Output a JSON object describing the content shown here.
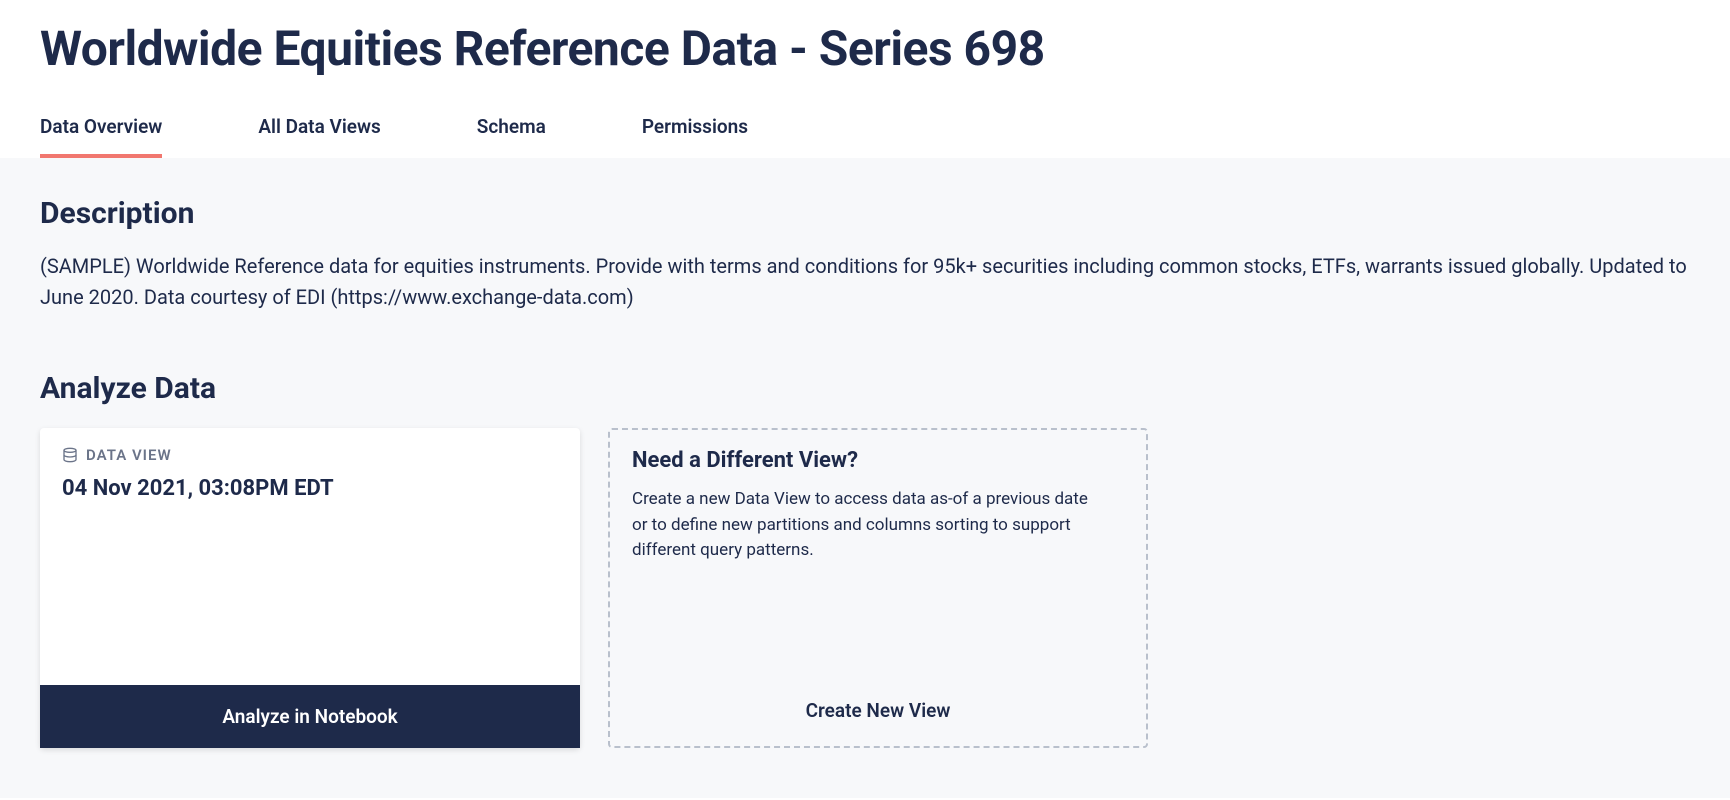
{
  "header": {
    "title": "Worldwide Equities Reference Data - Series 698"
  },
  "tabs": [
    {
      "label": "Data Overview",
      "active": true
    },
    {
      "label": "All Data Views",
      "active": false
    },
    {
      "label": "Schema",
      "active": false
    },
    {
      "label": "Permissions",
      "active": false
    }
  ],
  "description": {
    "heading": "Description",
    "body": "(SAMPLE) Worldwide Reference data for equities instruments. Provide with terms and conditions for 95k+ securities including common stocks, ETFs, warrants issued globally. Updated to June 2020. Data courtesy of EDI (https://www.exchange-data.com)"
  },
  "analyze": {
    "heading": "Analyze Data",
    "data_view": {
      "label": "DATA VIEW",
      "timestamp": "04 Nov 2021, 03:08PM EDT",
      "action": "Analyze in Notebook"
    },
    "create_view": {
      "title": "Need a Different View?",
      "body": "Create a new Data View to access data as-of a previous date or to define new partitions and columns sorting to support different query patterns.",
      "action": "Create New View"
    }
  }
}
